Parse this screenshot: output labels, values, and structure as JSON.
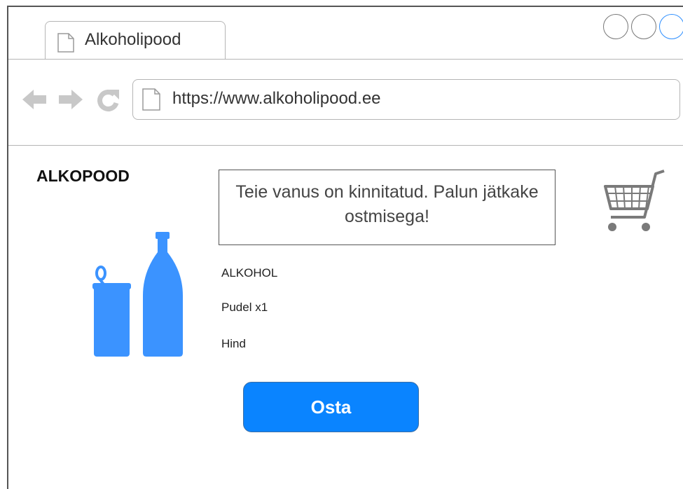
{
  "browser": {
    "tab_title": "Alkoholipood",
    "url": "https://www.alkoholipood.ee"
  },
  "page": {
    "brand": "ALKOPOOD",
    "message": "Teie vanus on kinnitatud. Palun jätkake ostmisega!",
    "product_name": "ALKOHOL",
    "quantity": "Pudel x1",
    "price_label": "Hind",
    "buy_button": "Osta"
  },
  "colors": {
    "accent": "#0a84ff",
    "bottle": "#3b93ff",
    "icon_gray": "#c8c8c8"
  },
  "icons": [
    "document-icon",
    "back-arrow-icon",
    "forward-arrow-icon",
    "reload-icon",
    "shopping-cart-icon",
    "can-icon",
    "bottle-icon"
  ]
}
